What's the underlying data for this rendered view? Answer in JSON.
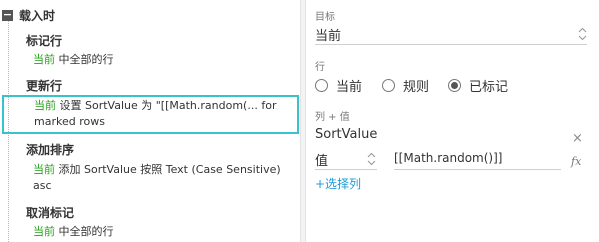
{
  "tree": {
    "event_title": "载入时",
    "collapse_symbol": "−",
    "cases": [
      {
        "title": "标记行",
        "action": {
          "keyword": "当前",
          "text": " 中全部的行"
        }
      },
      {
        "title": "更新行",
        "action": {
          "keyword": "当前",
          "text": " 设置 SortValue 为 \"[[Math.random(... for marked rows"
        },
        "selected": true
      },
      {
        "title": "添加排序",
        "action": {
          "keyword": "当前",
          "text": " 添加 SortValue 按照 Text (Case Sensitive) asc"
        }
      },
      {
        "title": "取消标记",
        "action": {
          "keyword": "当前",
          "text": " 中全部的行"
        }
      }
    ]
  },
  "props": {
    "target": {
      "label": "目标",
      "value": "当前"
    },
    "rows": {
      "label": "行",
      "options": [
        "当前",
        "规则",
        "已标记"
      ],
      "selected": "已标记"
    },
    "columns": {
      "label": "列 + 值",
      "column_name": "SortValue",
      "mode": "值",
      "value": "[[Math.random()]]",
      "fx": "fx",
      "close": "×",
      "add_label": "+选择列"
    }
  },
  "colors": {
    "keyword": "#26a21a",
    "selection_border": "#39c2c9",
    "link": "#1e9bd7"
  }
}
